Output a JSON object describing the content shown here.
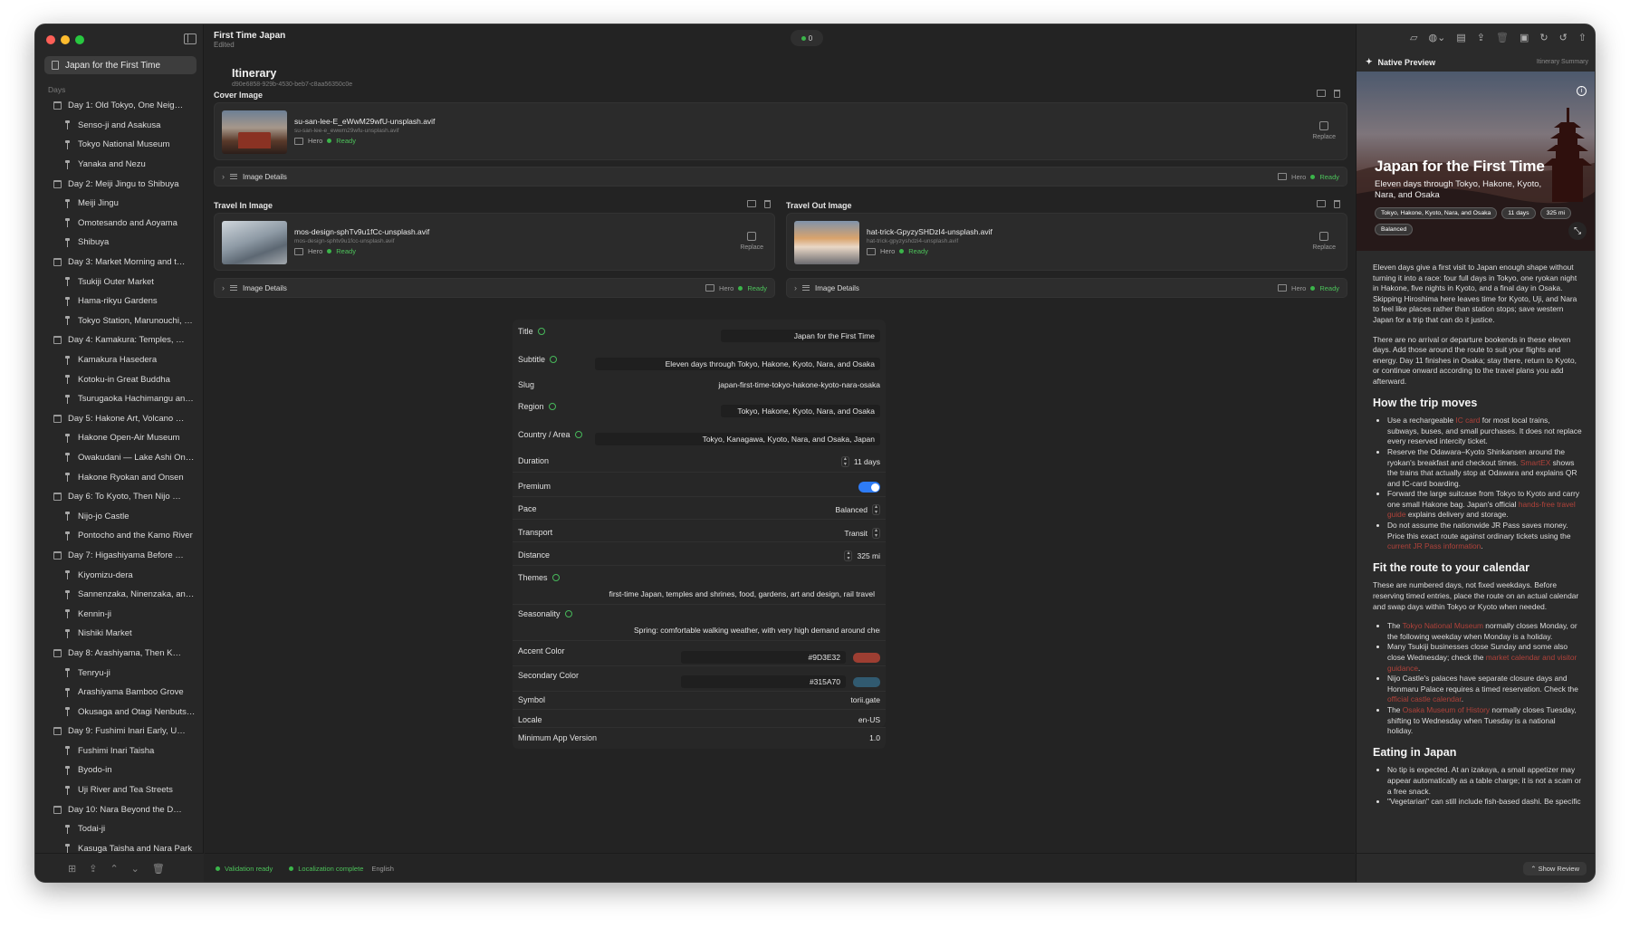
{
  "window": {
    "title": "First Time Japan",
    "subtitle": "Edited",
    "status_count": "0"
  },
  "sidebar": {
    "selected": "Japan for the First Time",
    "section": "Days",
    "items": [
      {
        "type": "day",
        "label": "Day 1: Old Tokyo, One Neighbor..."
      },
      {
        "type": "place",
        "label": "Senso-ji and Asakusa"
      },
      {
        "type": "place",
        "label": "Tokyo National Museum"
      },
      {
        "type": "place",
        "label": "Yanaka and Nezu"
      },
      {
        "type": "day",
        "label": "Day 2: Meiji Jingu to Shibuya"
      },
      {
        "type": "place",
        "label": "Meiji Jingu"
      },
      {
        "type": "place",
        "label": "Omotesando and Aoyama"
      },
      {
        "type": "place",
        "label": "Shibuya"
      },
      {
        "type": "day",
        "label": "Day 3: Market Morning and the..."
      },
      {
        "type": "place",
        "label": "Tsukiji Outer Market"
      },
      {
        "type": "place",
        "label": "Hama-rikyu Gardens"
      },
      {
        "type": "place",
        "label": "Tokyo Station, Marunouchi, a..."
      },
      {
        "type": "day",
        "label": "Day 4: Kamakura: Temples, Sea..."
      },
      {
        "type": "place",
        "label": "Kamakura Hasedera"
      },
      {
        "type": "place",
        "label": "Kotoku-in Great Buddha"
      },
      {
        "type": "place",
        "label": "Tsurugaoka Hachimangu and..."
      },
      {
        "type": "day",
        "label": "Day 5: Hakone Art, Volcano Cou..."
      },
      {
        "type": "place",
        "label": "Hakone Open-Air Museum"
      },
      {
        "type": "place",
        "label": "Owakudani — Lake Ashi Only..."
      },
      {
        "type": "place",
        "label": "Hakone Ryokan and Onsen"
      },
      {
        "type": "day",
        "label": "Day 6: To Kyoto, Then Nijo Castle"
      },
      {
        "type": "place",
        "label": "Nijo-jo Castle"
      },
      {
        "type": "place",
        "label": "Pontocho and the Kamo River"
      },
      {
        "type": "day",
        "label": "Day 7: Higashiyama Before the..."
      },
      {
        "type": "place",
        "label": "Kiyomizu-dera"
      },
      {
        "type": "place",
        "label": "Sannenzaka, Ninenzaka, and..."
      },
      {
        "type": "place",
        "label": "Kennin-ji"
      },
      {
        "type": "place",
        "label": "Nishiki Market"
      },
      {
        "type": "day",
        "label": "Day 8: Arashiyama, Then Keep..."
      },
      {
        "type": "place",
        "label": "Tenryu-ji"
      },
      {
        "type": "place",
        "label": "Arashiyama Bamboo Grove"
      },
      {
        "type": "place",
        "label": "Okusaga and Otagi Nenbutsu..."
      },
      {
        "type": "day",
        "label": "Day 9: Fushimi Inari Early, Uji Slo..."
      },
      {
        "type": "place",
        "label": "Fushimi Inari Taisha"
      },
      {
        "type": "place",
        "label": "Byodo-in"
      },
      {
        "type": "place",
        "label": "Uji River and Tea Streets"
      },
      {
        "type": "day",
        "label": "Day 10: Nara Beyond the Deer P..."
      },
      {
        "type": "place",
        "label": "Todai-ji"
      },
      {
        "type": "place",
        "label": "Kasuga Taisha and Nara Park"
      }
    ]
  },
  "main": {
    "heading": "Itinerary",
    "id": "d90e6858-929b-4530-beb7-c8aa56350c0e",
    "cover": {
      "section": "Cover Image",
      "file": "su-san-lee-E_eWwM29wfU-unsplash.avif",
      "file_sub": "su-san-lee-e_ewwm29wfu-unsplash.avif",
      "tag": "Hero",
      "status": "Ready",
      "replace": "Replace",
      "details": "Image Details"
    },
    "travel_in": {
      "section": "Travel In Image",
      "file": "mos-design-sphTv9u1fCc-unsplash.avif",
      "file_sub": "mos-design-sphtv9u1fcc-unsplash.avif",
      "tag": "Hero",
      "status": "Ready",
      "replace": "Replace",
      "details": "Image Details"
    },
    "travel_out": {
      "section": "Travel Out Image",
      "file": "hat-trick-GpyzySHDzI4-unsplash.avif",
      "file_sub": "hat-trick-gpyzyshdzi4-unsplash.avif",
      "tag": "Hero",
      "status": "Ready",
      "replace": "Replace",
      "details": "Image Details"
    }
  },
  "form": {
    "title_label": "Title",
    "title": "Japan for the First Time",
    "subtitle_label": "Subtitle",
    "subtitle": "Eleven days through Tokyo, Hakone, Kyoto, Nara, and Osaka",
    "slug_label": "Slug",
    "slug": "japan-first-time-tokyo-hakone-kyoto-nara-osaka",
    "region_label": "Region",
    "region": "Tokyo, Hakone, Kyoto, Nara, and Osaka",
    "country_label": "Country / Area",
    "country": "Tokyo, Kanagawa, Kyoto, Nara, and Osaka, Japan",
    "duration_label": "Duration",
    "duration": "11 days",
    "premium_label": "Premium",
    "premium": true,
    "pace_label": "Pace",
    "pace": "Balanced",
    "transport_label": "Transport",
    "transport": "Transit",
    "distance_label": "Distance",
    "distance": "325 mi",
    "themes_label": "Themes",
    "themes": "first-time Japan, temples and shrines, food, gardens, art and design, rail travel",
    "seasonality_label": "Seasonality",
    "seasonality": "Spring: comfortable walking weather, with very high demand around cherry blo",
    "accent_label": "Accent Color",
    "accent": "#9D3E32",
    "secondary_label": "Secondary Color",
    "secondary": "#315A70",
    "symbol_label": "Symbol",
    "symbol": "torii.gate",
    "locale_label": "Locale",
    "locale": "en-US",
    "minver_label": "Minimum App Version",
    "minver": "1.0"
  },
  "footer": {
    "validation": "Validation ready",
    "localization": "Localization complete",
    "language": "English"
  },
  "preview": {
    "header": "Native Preview",
    "summary": "Itinerary Summary",
    "title": "Japan for the First Time",
    "subtitle": "Eleven days through Tokyo, Hakone, Kyoto, Nara, and Osaka",
    "chips": [
      "Tokyo, Hakone, Kyoto, Nara, and Osaka",
      "11 days",
      "325 mi",
      "Balanced"
    ],
    "p1": "Eleven days give a first visit to Japan enough shape without turning it into a race: four full days in Tokyo, one ryokan night in Hakone, five nights in Kyoto, and a final day in Osaka. Skipping Hiroshima here leaves time for Kyoto, Uji, and Nara to feel like places rather than station stops; save western Japan for a trip that can do it justice.",
    "p2": "There are no arrival or departure bookends in these eleven days. Add those around the route to suit your flights and energy. Day 11 finishes in Osaka; stay there, return to Kyoto, or continue onward according to the travel plans you add afterward.",
    "h1": "How the trip moves",
    "b1a": "Use a rechargeable ",
    "b1l": "IC card",
    "b1b": " for most local trains, subways, buses, and small purchases. It does not replace every reserved intercity ticket.",
    "b2a": "Reserve the Odawara–Kyoto Shinkansen around the ryokan's breakfast and checkout times. ",
    "b2l": "SmartEX",
    "b2b": " shows the trains that actually stop at Odawara and explains QR and IC-card boarding.",
    "b3a": "Forward the large suitcase from Tokyo to Kyoto and carry one small Hakone bag. Japan's official ",
    "b3l": "hands-free travel guide",
    "b3b": " explains delivery and storage.",
    "b4a": "Do not assume the nationwide JR Pass saves money. Price this exact route against ordinary tickets using the ",
    "b4l": "current JR Pass information",
    "b4b": ".",
    "h2": "Fit the route to your calendar",
    "p3": "These are numbered days, not fixed weekdays. Before reserving timed entries, place the route on an actual calendar and swap days within Tokyo or Kyoto when needed.",
    "c1a": "The ",
    "c1l": "Tokyo National Museum",
    "c1b": " normally closes Monday, or the following weekday when Monday is a holiday.",
    "c2a": "Many Tsukiji businesses close Sunday and some also close Wednesday; check the ",
    "c2l": "market calendar and visitor guidance",
    "c2b": ".",
    "c3a": "Nijo Castle's palaces have separate closure days and Honmaru Palace requires a timed reservation. Check the ",
    "c3l": "official castle calendar",
    "c3b": ".",
    "c4a": "The ",
    "c4l": "Osaka Museum of History",
    "c4b": " normally closes Tuesday, shifting to Wednesday when Tuesday is a national holiday.",
    "h3": "Eating in Japan",
    "e1": "No tip is expected. At an izakaya, a small appetizer may appear automatically as a table charge; it is not a scam or a free snack.",
    "e2": "\"Vegetarian\" can still include fish-based dashi. Be specific",
    "show_review": "Show Review"
  },
  "colors": {
    "accent": "#9D3E32",
    "secondary": "#315A70",
    "ready": "#4cc25a",
    "toggle": "#2e7cf6"
  }
}
